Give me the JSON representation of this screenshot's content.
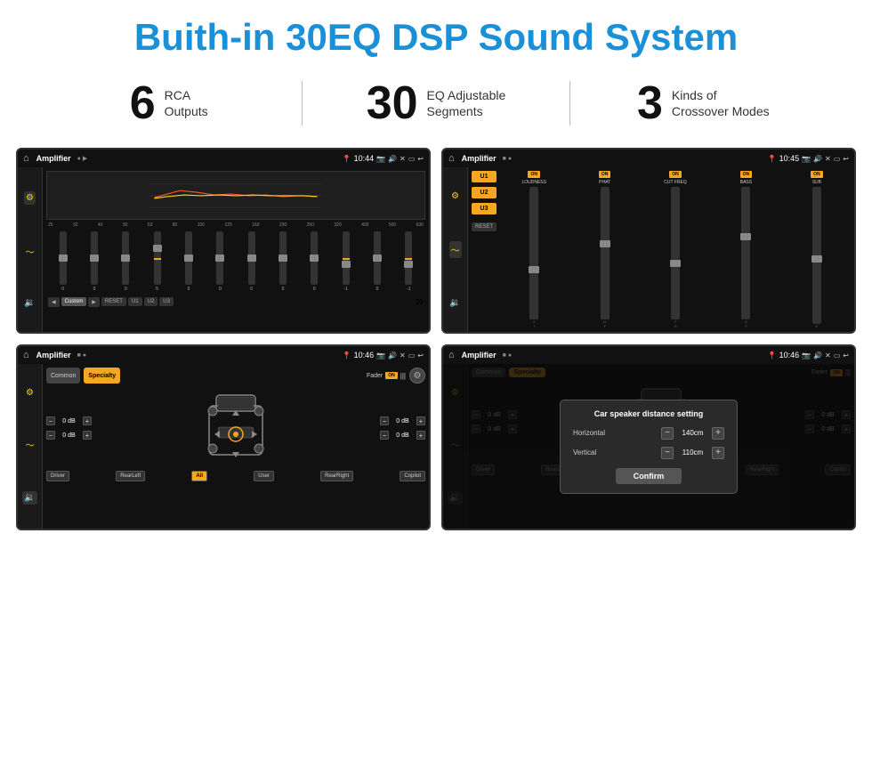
{
  "header": {
    "title": "Buith-in 30EQ DSP Sound System"
  },
  "stats": [
    {
      "number": "6",
      "label": "RCA\nOutputs"
    },
    {
      "number": "30",
      "label": "EQ Adjustable\nSegments"
    },
    {
      "number": "3",
      "label": "Kinds of\nCrossover Modes"
    }
  ],
  "screens": [
    {
      "id": "screen1",
      "status": {
        "title": "Amplifier",
        "time": "10:44"
      },
      "type": "eq"
    },
    {
      "id": "screen2",
      "status": {
        "title": "Amplifier",
        "time": "10:45"
      },
      "type": "amp"
    },
    {
      "id": "screen3",
      "status": {
        "title": "Amplifier",
        "time": "10:46"
      },
      "type": "fader"
    },
    {
      "id": "screen4",
      "status": {
        "title": "Amplifier",
        "time": "10:46"
      },
      "type": "fader-dialog"
    }
  ],
  "eq": {
    "freqs": [
      "25",
      "32",
      "40",
      "50",
      "63",
      "80",
      "100",
      "125",
      "160",
      "200",
      "250",
      "320",
      "400",
      "500",
      "630"
    ],
    "values": [
      "0",
      "0",
      "0",
      "5",
      "0",
      "0",
      "0",
      "0",
      "0",
      "0",
      "-1",
      "0",
      "-1"
    ],
    "buttons": [
      "Custom",
      "RESET",
      "U1",
      "U2",
      "U3"
    ]
  },
  "amp": {
    "presets": [
      "U1",
      "U2",
      "U3"
    ],
    "channels": [
      {
        "label": "LOUDNESS",
        "on": true
      },
      {
        "label": "PHAT",
        "on": true
      },
      {
        "label": "CUT FREQ",
        "on": true
      },
      {
        "label": "BASS",
        "on": true
      },
      {
        "label": "SUB",
        "on": true
      }
    ]
  },
  "fader": {
    "buttons": [
      "Common",
      "Specialty"
    ],
    "label": "Fader",
    "on": "ON",
    "controls": [
      {
        "value": "0 dB"
      },
      {
        "value": "0 dB"
      },
      {
        "value": "0 dB"
      },
      {
        "value": "0 dB"
      }
    ],
    "bottom_buttons": [
      "Driver",
      "RearLeft",
      "All",
      "User",
      "RearRight",
      "Copilot"
    ]
  },
  "dialog": {
    "title": "Car speaker distance setting",
    "fields": [
      {
        "label": "Horizontal",
        "value": "140cm"
      },
      {
        "label": "Vertical",
        "value": "110cm"
      }
    ],
    "confirm": "Confirm"
  }
}
